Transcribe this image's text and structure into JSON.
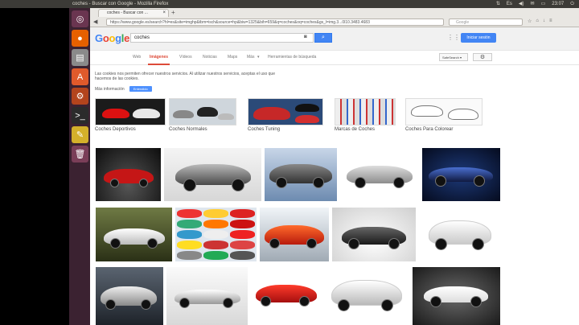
{
  "system": {
    "window_title": "coches - Buscar con Google - Mozilla Firefox",
    "clock": "23:07",
    "tray_icons": [
      "network-icon",
      "keyboard-layout-icon",
      "volume-icon",
      "mail-icon",
      "battery-icon"
    ]
  },
  "browser": {
    "tab_title": "coches - Buscar con ...",
    "url": "https://www.google.es/search?hl=es&site=imghp&tbm=isch&source=hp&biw=1325&bih=659&q=coches&oq=coches&gs_l=img.3...0l10.3483.4683",
    "search_placeholder": "Google"
  },
  "google": {
    "logo": [
      "G",
      "o",
      "o",
      "g",
      "l",
      "e"
    ],
    "logo_colors": [
      "#4285f4",
      "#ea4335",
      "#fbbc05",
      "#4285f4",
      "#34a853",
      "#ea4335"
    ],
    "query": "coches",
    "signin_label": "Iniciar sesión",
    "nav": [
      "Web",
      "Imágenes",
      "Vídeos",
      "Noticias",
      "Maps",
      "Más",
      "Herramientas de búsqueda"
    ],
    "safesearch": "SafeSearch",
    "cookie_text": "Las cookies nos permiten ofrecer nuestros servicios. Al utilizar nuestros servicios, aceptas el uso que hacemos de las cookies.",
    "more_info": "Más información",
    "ok": "Entendido"
  },
  "related": [
    {
      "label": "Coches Deportivos"
    },
    {
      "label": "Coches Normales"
    },
    {
      "label": "Coches Tuning"
    },
    {
      "label": "Marcas de Coches"
    },
    {
      "label": "Coches Para Colorear"
    }
  ],
  "colors": {
    "accent_red": "#dd4b39",
    "blue": "#4285f4",
    "launcher": "#4a2337"
  }
}
